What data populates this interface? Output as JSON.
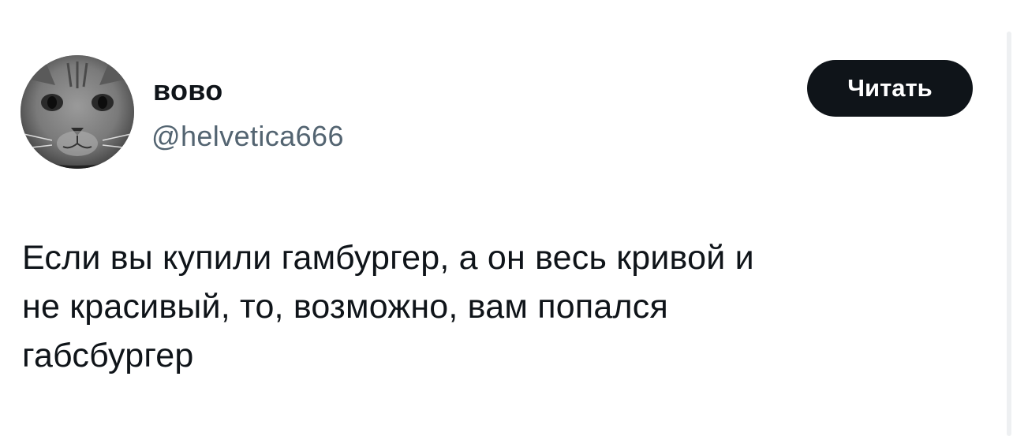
{
  "author": {
    "display_name": "вово",
    "handle": "@helvetica666",
    "avatar_icon": "cat-avatar-icon"
  },
  "follow_button": {
    "label": "Читать"
  },
  "tweet": {
    "lines": [
      "Если вы купили гамбургер, а он весь кривой и",
      "не красивый, то, возможно, вам попался",
      "габсбургер"
    ]
  },
  "colors": {
    "text": "#0f1419",
    "secondary_text": "#536471",
    "button_bg": "#0f1419",
    "button_text": "#ffffff",
    "background": "#ffffff"
  }
}
